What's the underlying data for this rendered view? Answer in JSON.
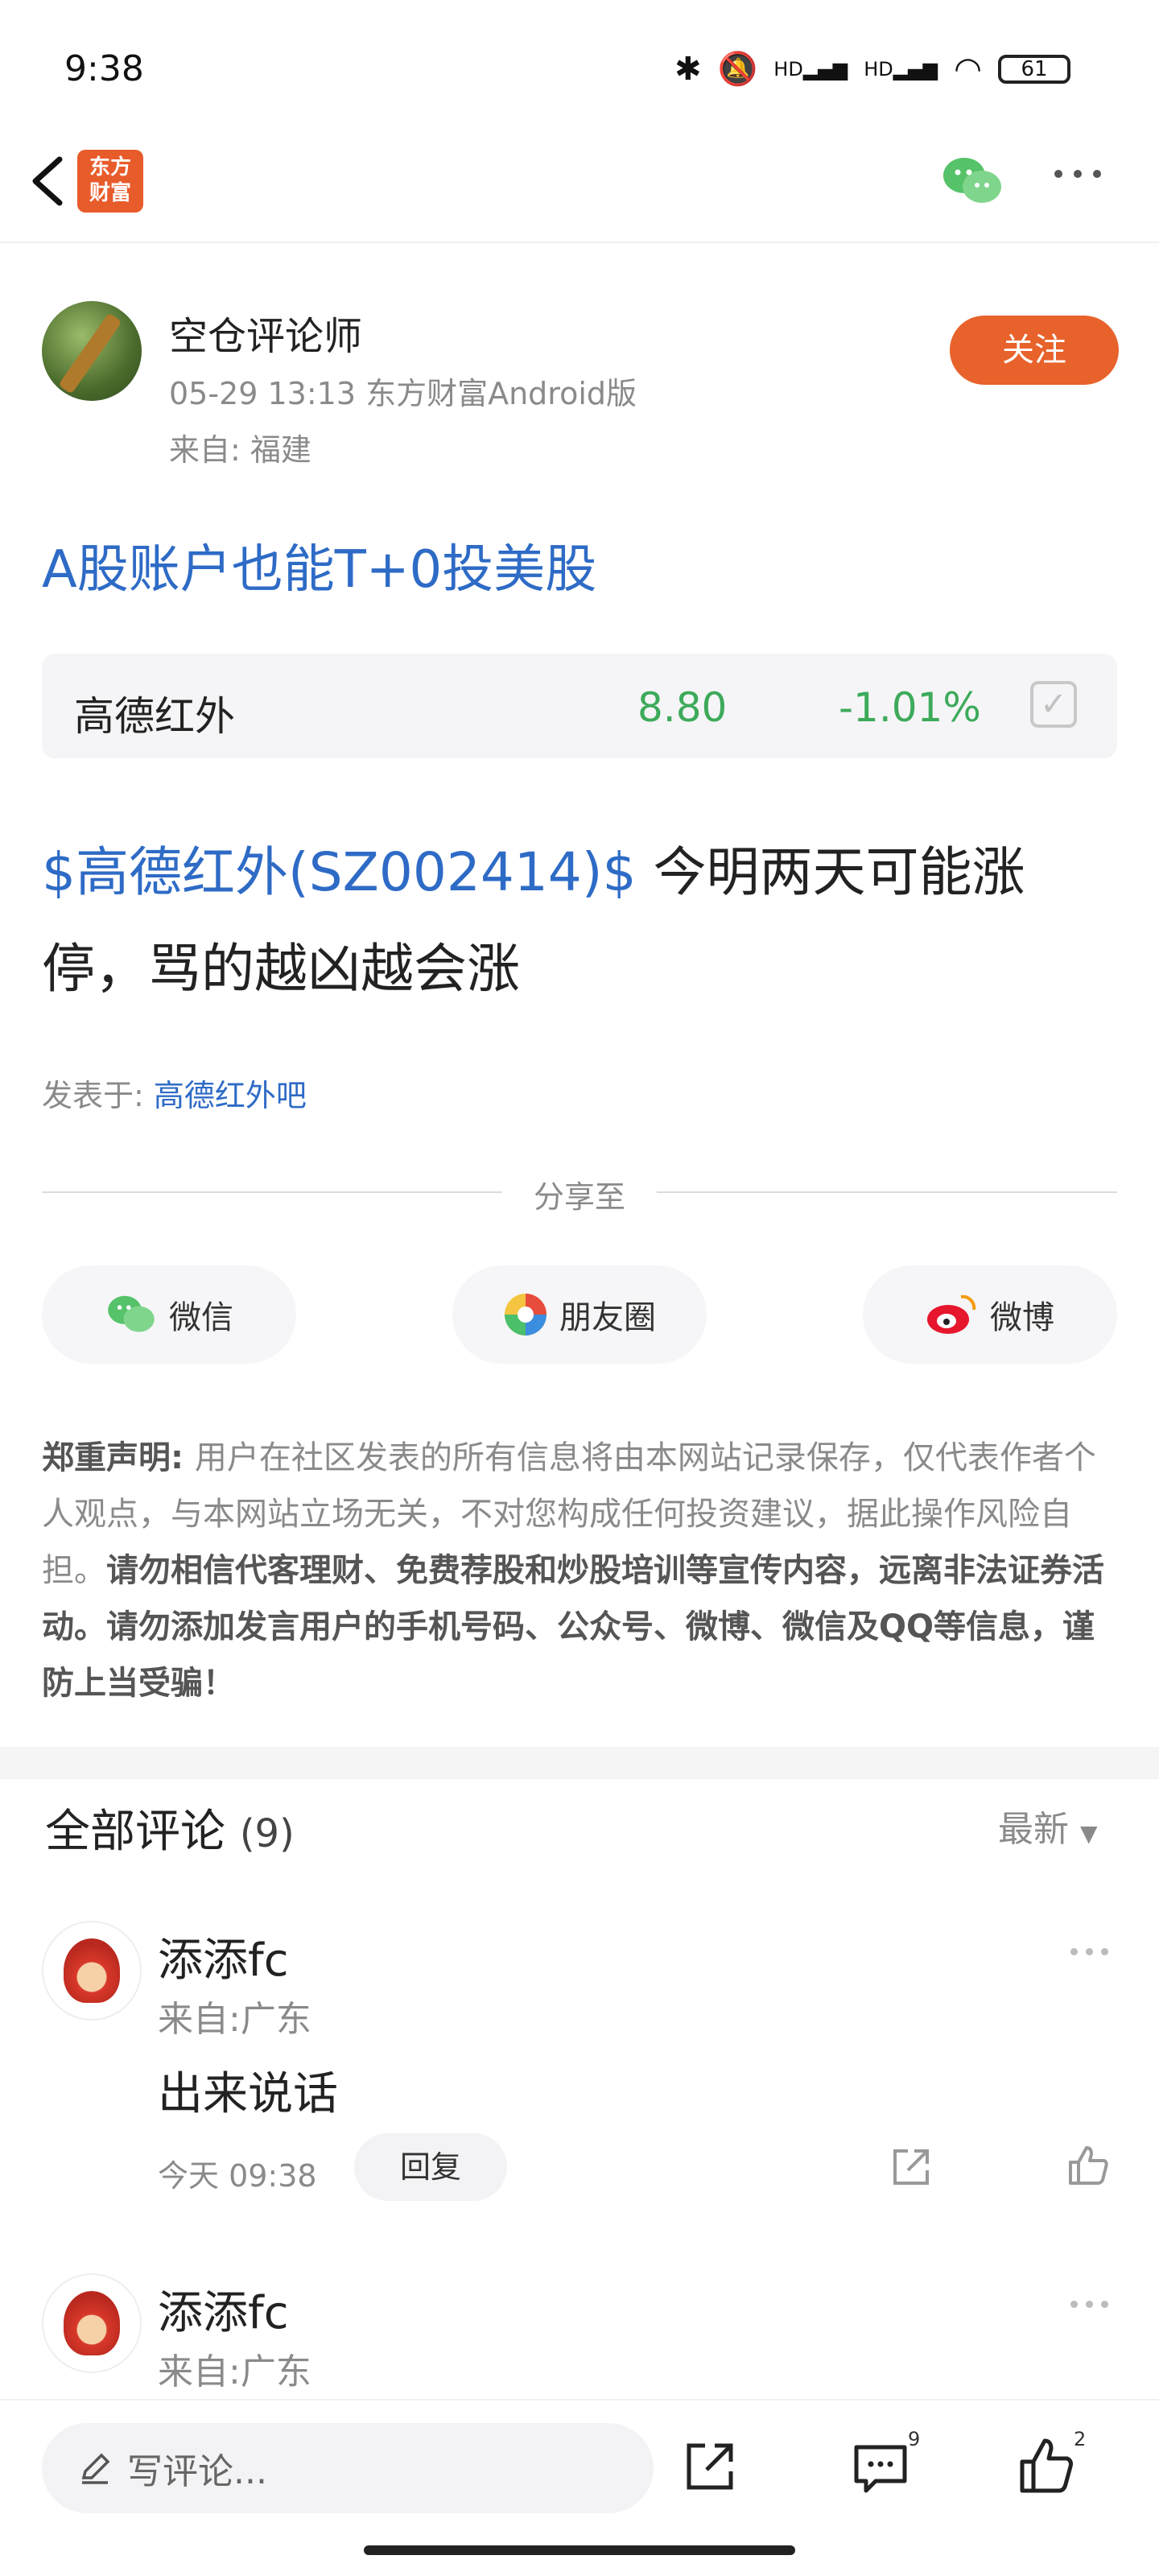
{
  "status_bar": {
    "time": "9:38",
    "battery": "61",
    "hd1": "HD",
    "hd2": "HD"
  },
  "header": {
    "logo_line1": "东方",
    "logo_line2": "财富"
  },
  "author": {
    "name": "空仓评论师",
    "meta": "05-29 13:13 东方财富Android版",
    "from": "来自: 福建",
    "follow_label": "关注"
  },
  "post": {
    "title": "A股账户也能T+0投美股",
    "stock": {
      "name": "高德红外",
      "price": "8.80",
      "change": "-1.01%"
    },
    "body_tag": "$高德红外(SZ002414)$",
    "body_text": " 今明两天可能涨停，骂的越凶越会涨",
    "posted_in_label": "发表于: ",
    "posted_in_bar": "高德红外吧"
  },
  "share": {
    "label": "分享至",
    "wechat": "微信",
    "moments": "朋友圈",
    "weibo": "微博"
  },
  "disclaimer": {
    "head": "郑重声明: ",
    "normal": "用户在社区发表的所有信息将由本网站记录保存，仅代表作者个人观点，与本网站立场无关，不对您构成任何投资建议，据此操作风险自担。",
    "bold": "请勿相信代客理财、免费荐股和炒股培训等宣传内容，远离非法证券活动。请勿添加发言用户的手机号码、公众号、微博、微信及QQ等信息，谨防上当受骗！"
  },
  "comments": {
    "title": "全部评论",
    "count": "(9)",
    "sort": "最新",
    "items": [
      {
        "name": "添添fc",
        "from": "来自:广东",
        "text": "出来说话",
        "time": "今天 09:38",
        "reply": "回复"
      },
      {
        "name": "添添fc",
        "from": "来自:广东"
      }
    ]
  },
  "bottom_bar": {
    "write_placeholder": "写评论...",
    "comment_count": "9",
    "like_count": "2"
  },
  "colors": {
    "accent": "#e8622b",
    "link": "#2e6bc6",
    "down_green": "#3daa5a"
  }
}
